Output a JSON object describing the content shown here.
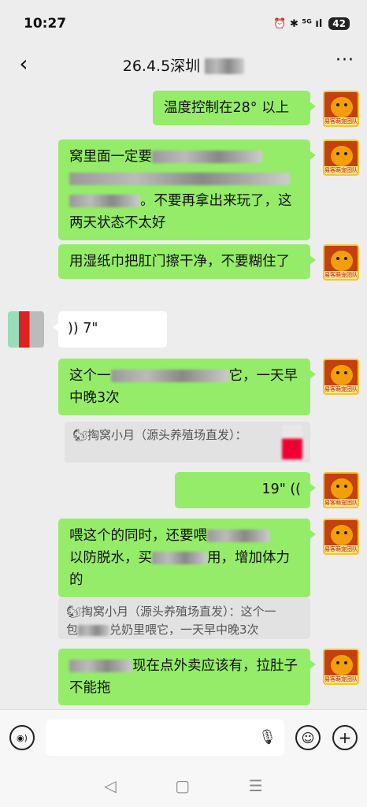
{
  "status": {
    "time": "10:27",
    "icons": "⏰ ✱ ⁵ᴳ ıl",
    "battery": "42"
  },
  "header": {
    "back_glyph": "‹",
    "title": "26.4.5深圳",
    "more_glyph": "···"
  },
  "avatar_tag": "易客萌宠团队",
  "messages": [
    {
      "side": "right",
      "text": "温度控制在28° 以上"
    },
    {
      "side": "right",
      "text_a": "窝里面一定要",
      "text_b": "。不要再拿出来玩了，这两天状态不太好"
    },
    {
      "side": "right",
      "text": "用湿纸巾把肛门擦干净，不要糊住了"
    },
    {
      "side": "left",
      "voice": "7\""
    },
    {
      "side": "right",
      "text_a": "这个一",
      "text_b": "它，一天早中晚3次"
    },
    {
      "side": "right",
      "voice": "19\""
    },
    {
      "side": "right",
      "text_a": "喂这个的同时，还要喂",
      "text_b": "以防脱水，买",
      "text_c": "用，增加体力的"
    },
    {
      "side": "right",
      "text_a": "现在点外卖应该有，拉肚子不能拖"
    }
  ],
  "quotes": [
    {
      "text": "🐿掏窝小月（源头养殖场直发）："
    },
    {
      "text_a": "🐿掏窝小月（源头养殖场直发）：这个一",
      "text_b": "包",
      "text_c": "兑奶里喂它，一天早中晚3次"
    }
  ],
  "input_bar": {
    "voice_icon": "◉)",
    "mic_icon": "🎙",
    "emoji_icon": "☺",
    "plus_icon": "+"
  },
  "sysnav": {
    "back": "◁",
    "home": "▢",
    "menu": "☰"
  }
}
